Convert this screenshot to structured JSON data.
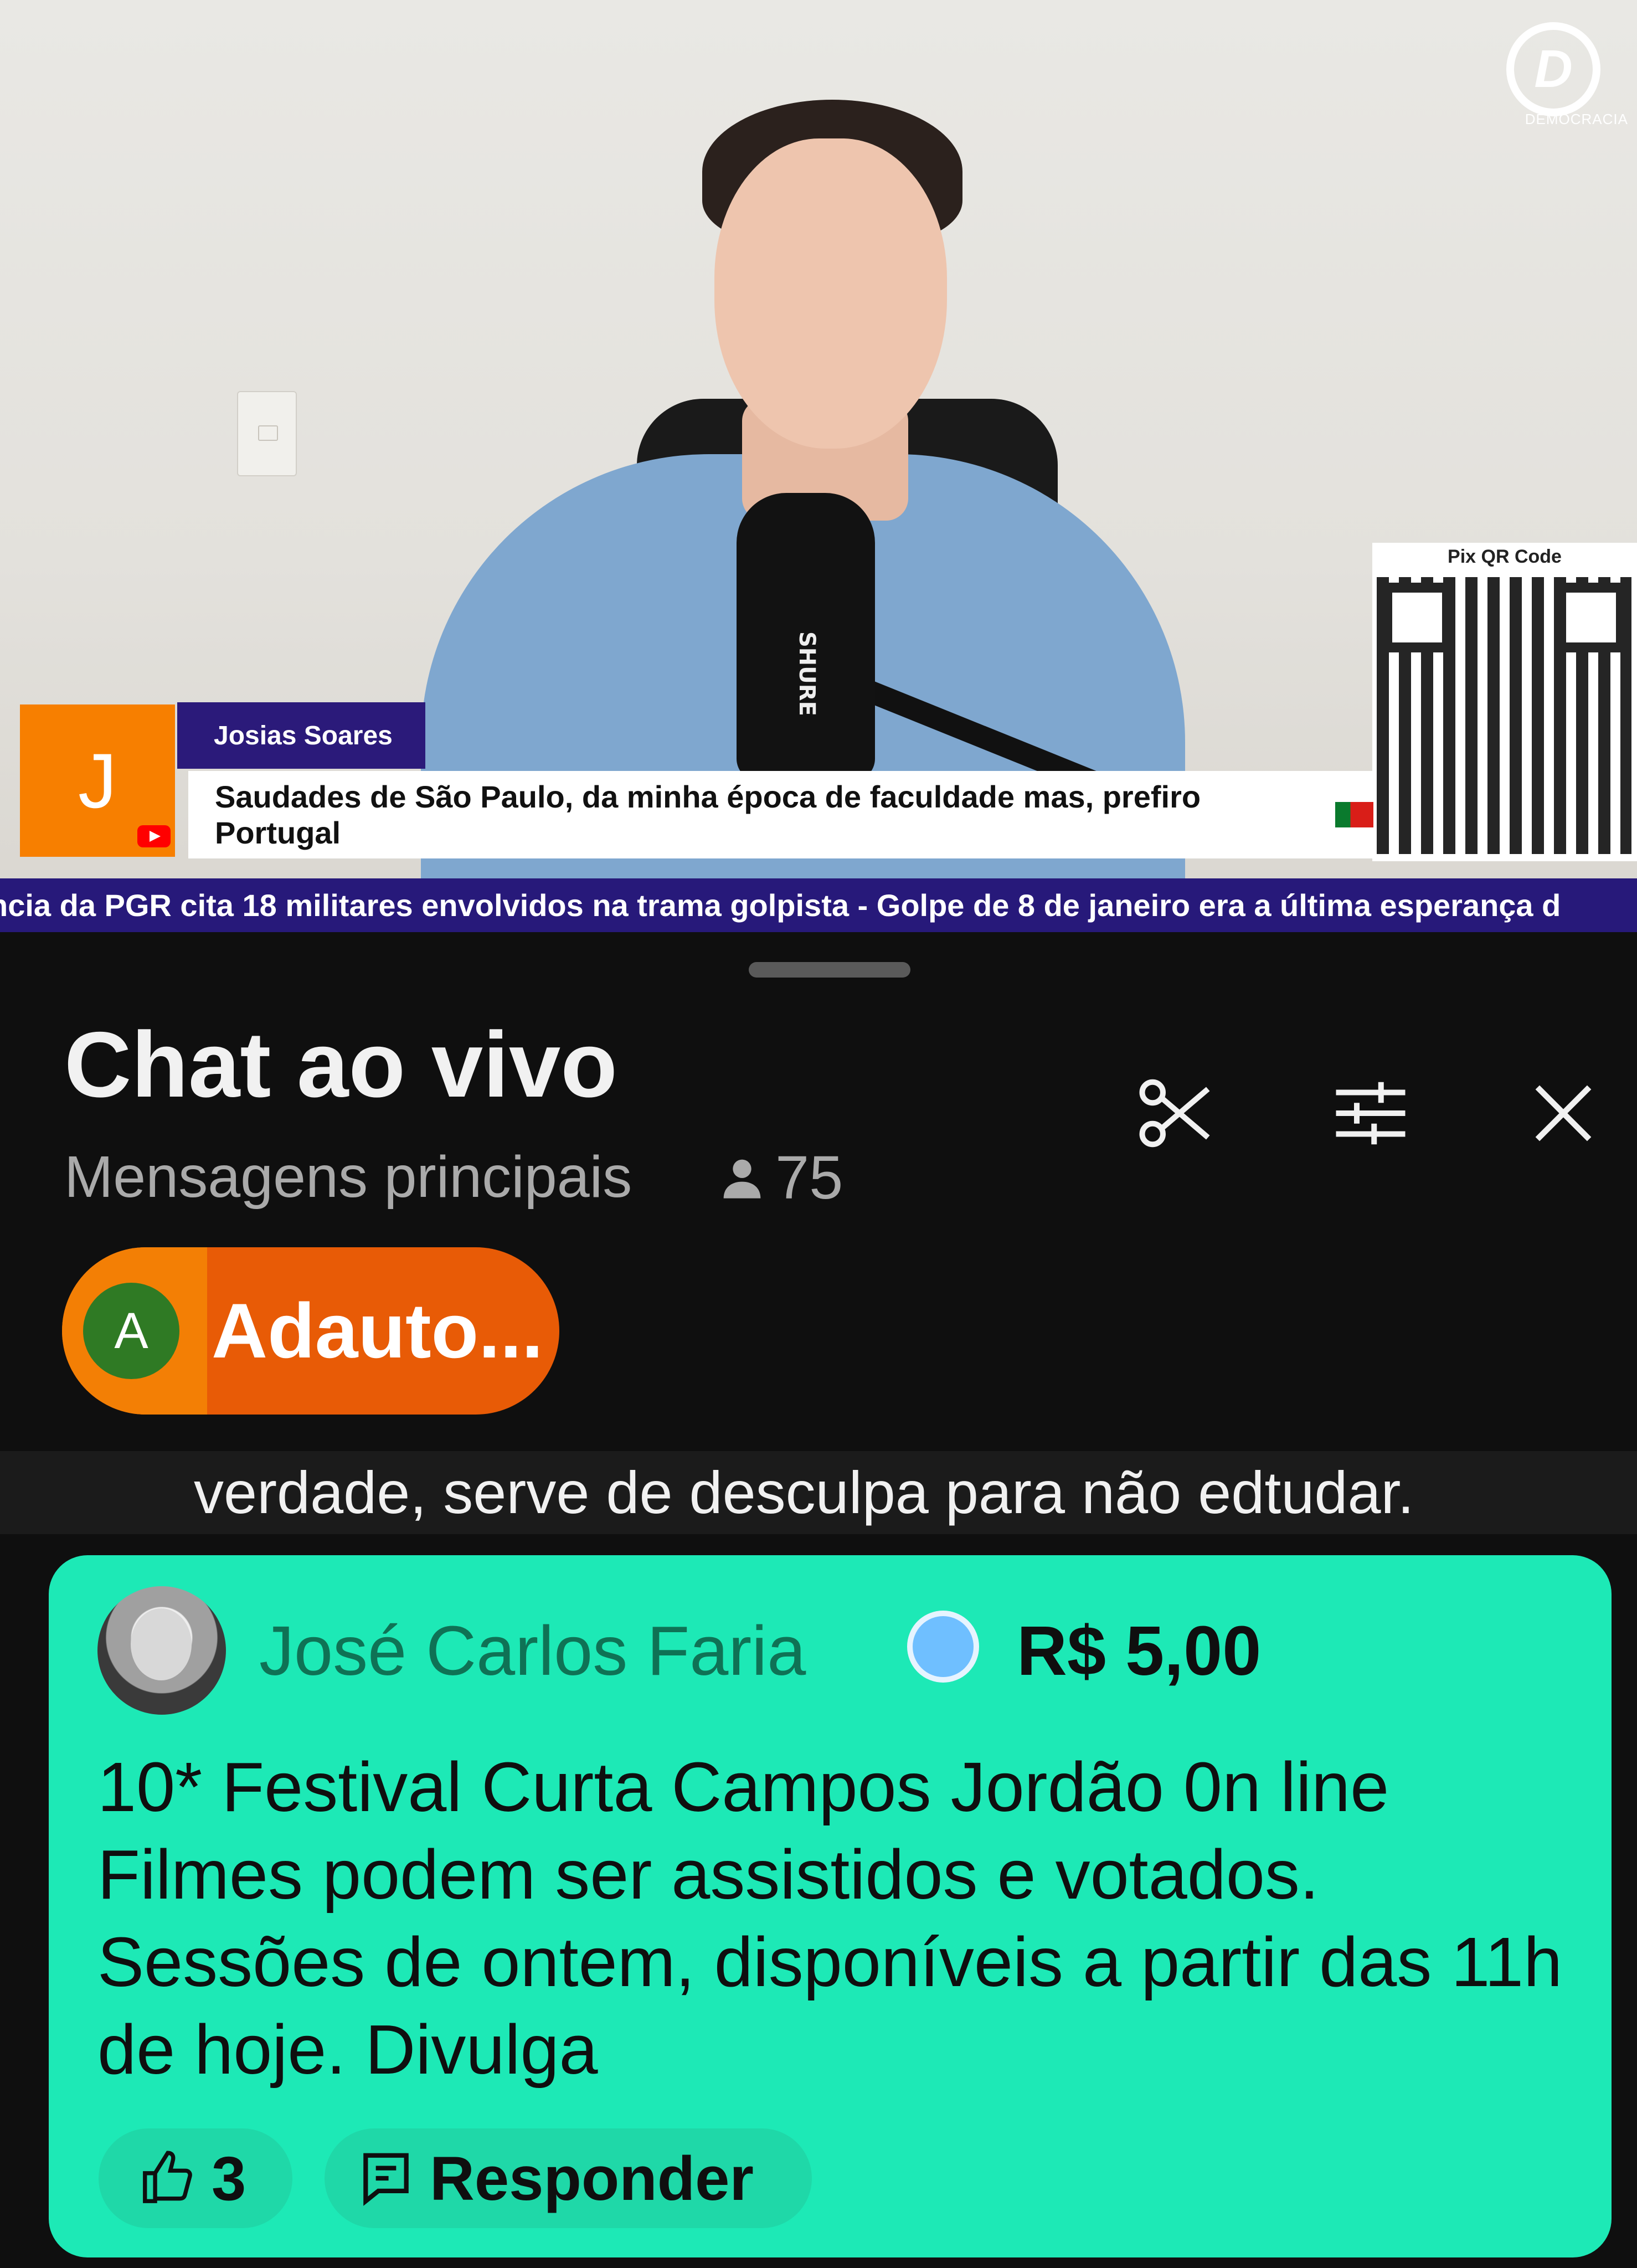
{
  "video": {
    "channel_logo": "D",
    "channel_logo_caption": "DEMOCRACIA",
    "mic_brand": "SHURE",
    "qr_title": "Pix QR Code",
    "lower_third": {
      "initial": "J",
      "name": "Josias Soares",
      "comment": "Saudades de São Paulo, da minha época de faculdade mas, prefiro Portugal"
    },
    "ticker": "ncia da PGR cita 18 militares envolvidos na trama golpista - Golpe de 8 de janeiro era a última esperança d"
  },
  "chat": {
    "title": "Chat ao vivo",
    "mode": "Mensagens principais",
    "viewer_count": "75",
    "icons": {
      "clip": "scissors-icon",
      "filter": "sliders-icon",
      "close": "close-icon",
      "viewer": "person-icon"
    },
    "pinned": {
      "avatar_letter": "A",
      "name": "Adauto..."
    },
    "previous_message": "verdade, serve de desculpa para não edtudar.",
    "superchat": {
      "author": "José Carlos Faria",
      "amount": "R$ 5,00",
      "message": "10* Festival Curta Campos Jordão 0n line Filmes podem ser assistidos e votados. Sessões de ontem, disponíveis a partir das 11h de hoje. Divulga",
      "likes": "3",
      "reply_label": "Responder",
      "background": "#1de9b6",
      "author_color": "#0f7255"
    }
  }
}
